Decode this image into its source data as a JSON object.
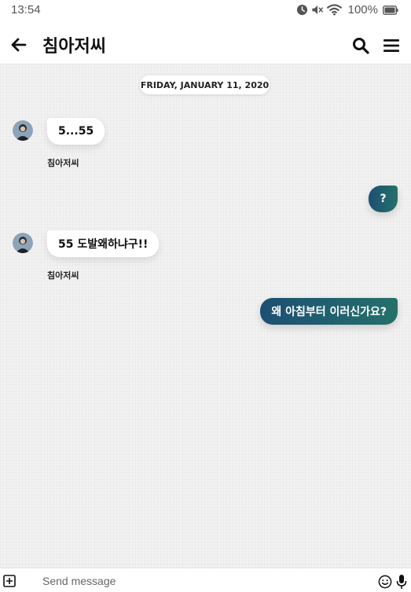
{
  "status_bar": {
    "time": "13:54",
    "battery_percent": "100%",
    "icons": [
      "alarm-icon",
      "mute-icon",
      "wifi-icon",
      "battery-icon"
    ]
  },
  "header": {
    "title": "침아저씨",
    "icons": [
      "back-arrow-icon",
      "search-icon",
      "menu-icon"
    ]
  },
  "chat": {
    "date_separator": "FRIDAY, JANUARY 11, 2020",
    "messages": [
      {
        "direction": "incoming",
        "text": "5...55",
        "sender": "침아저씨"
      },
      {
        "direction": "outgoing",
        "text": "?"
      },
      {
        "direction": "incoming",
        "text": "55 도발왜하냐구!!",
        "sender": "침아저씨"
      },
      {
        "direction": "outgoing",
        "text": "왜 아침부터 이러신가요?"
      }
    ]
  },
  "composer": {
    "placeholder": "Send message",
    "icons": [
      "add-attachment-icon",
      "emoji-icon",
      "microphone-icon"
    ]
  },
  "colors": {
    "outgoing_bubble_start": "#1d4f73",
    "outgoing_bubble_end": "#25706a",
    "chat_background": "#f2f2f2",
    "incoming_bubble": "#ffffff"
  }
}
